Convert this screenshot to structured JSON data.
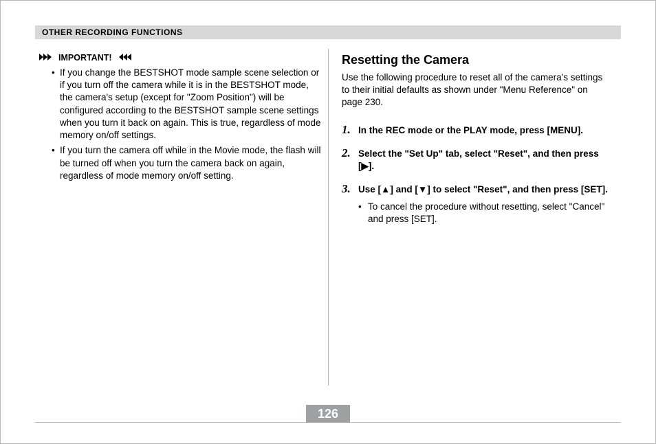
{
  "header": {
    "section_title": "OTHER RECORDING FUNCTIONS"
  },
  "left": {
    "important_label": "IMPORTANT!",
    "bullets": [
      "If you change the BESTSHOT mode sample scene selection or if you turn off the camera while it is in the BESTSHOT mode, the camera's setup (except for \"Zoom Position\") will be configured according to the BESTSHOT sample scene settings when you turn it back on again. This is true, regardless of mode memory on/off settings.",
      "If you turn the camera off while in the Movie mode, the flash will be turned off when you turn the camera back on again, regardless of mode memory on/off setting."
    ]
  },
  "right": {
    "title": "Resetting the Camera",
    "intro": "Use the following procedure to reset all of the camera's settings to their initial defaults as shown under \"Menu Reference\" on page 230.",
    "steps": [
      {
        "text": "In the REC mode or the PLAY mode, press [MENU]."
      },
      {
        "text": "Select the \"Set Up\" tab, select \"Reset\", and then press [▶]."
      },
      {
        "text": "Use [▲] and [▼] to select \"Reset\", and then press [SET].",
        "sub": [
          "To cancel the procedure without resetting, select \"Cancel\" and press [SET]."
        ]
      }
    ]
  },
  "footer": {
    "page_number": "126"
  }
}
